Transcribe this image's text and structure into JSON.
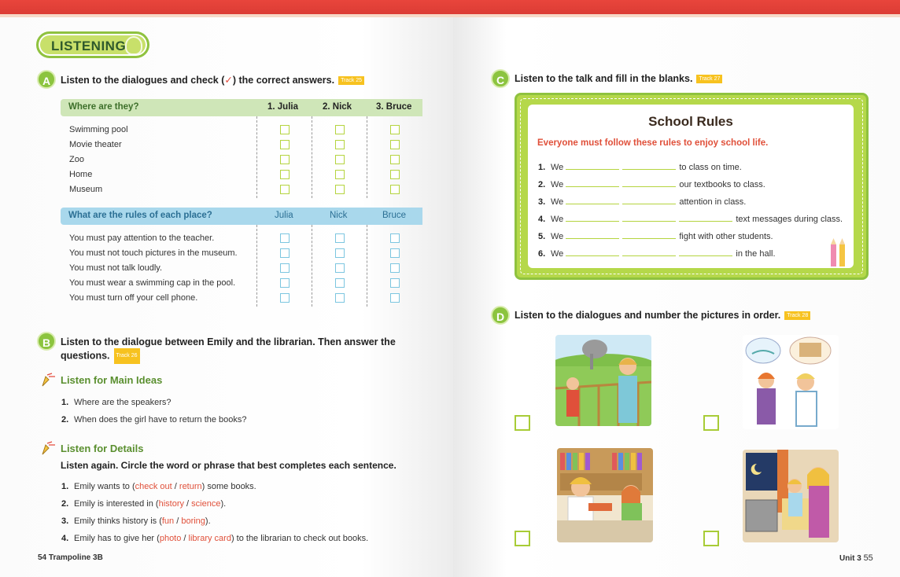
{
  "left_page": {
    "section_title": "LISTENING",
    "section_a": {
      "badge": "A",
      "instruction_before": "Listen to the dialogues and check (",
      "check_symbol": "✓",
      "instruction_after": ") the correct answers.",
      "track": "Track 25",
      "table1": {
        "headers": [
          "Where are they?",
          "1. Julia",
          "2. Nick",
          "3. Bruce"
        ],
        "rows": [
          "Swimming pool",
          "Movie theater",
          "Zoo",
          "Home",
          "Museum"
        ]
      },
      "table2": {
        "headers": [
          "What are the rules of each place?",
          "Julia",
          "Nick",
          "Bruce"
        ],
        "rows": [
          "You must pay attention to the teacher.",
          "You must not touch pictures in the museum.",
          "You must not talk loudly.",
          "You must wear a swimming cap in the pool.",
          "You must turn off your cell phone."
        ]
      }
    },
    "section_b": {
      "badge": "B",
      "instruction_line1": "Listen to the dialogue between Emily and the librarian. Then answer the",
      "instruction_line2": "questions.",
      "track": "Track 26",
      "main_ideas": {
        "heading": "Listen for Main Ideas",
        "items": [
          {
            "num": "1.",
            "text": "Where are the speakers?"
          },
          {
            "num": "2.",
            "text": "When does the girl have to return the books?"
          }
        ]
      },
      "details": {
        "heading": "Listen for Details",
        "instruction": "Listen again. Circle the word or phrase that best completes each sentence.",
        "items": [
          {
            "num": "1.",
            "pre": "Emily wants to (",
            "opt1": "check out",
            "sep": " / ",
            "opt2": "return",
            "post": ") some books."
          },
          {
            "num": "2.",
            "pre": "Emily is interested in (",
            "opt1": "history",
            "sep": " / ",
            "opt2": "science",
            "post": ")."
          },
          {
            "num": "3.",
            "pre": "Emily thinks history is (",
            "opt1": "fun",
            "sep": " / ",
            "opt2": "boring",
            "post": ")."
          },
          {
            "num": "4.",
            "pre": "Emily has to give her (",
            "opt1": "photo",
            "sep": " / ",
            "opt2": "library card",
            "post": ") to the librarian to check out books."
          }
        ]
      }
    },
    "footer": "54 Trampoline 3B"
  },
  "right_page": {
    "section_c": {
      "badge": "C",
      "instruction": "Listen to the talk and fill in the blanks.",
      "track": "Track 27",
      "card_title": "School Rules",
      "card_subtitle": "Everyone must follow these rules to enjoy school life.",
      "lines": [
        {
          "num": "1.",
          "pre": "We",
          "blanks": 2,
          "post": "to class on time."
        },
        {
          "num": "2.",
          "pre": "We",
          "blanks": 2,
          "post": "our textbooks to class."
        },
        {
          "num": "3.",
          "pre": "We",
          "blanks": 2,
          "post": "attention in class."
        },
        {
          "num": "4.",
          "pre": "We",
          "blanks": 3,
          "post": "text messages during class."
        },
        {
          "num": "5.",
          "pre": "We",
          "blanks": 2,
          "post": "fight with other students."
        },
        {
          "num": "6.",
          "pre": "We",
          "blanks": 3,
          "post": "in the hall."
        }
      ]
    },
    "section_d": {
      "badge": "D",
      "instruction": "Listen to the dialogues and number the pictures in order.",
      "track": "Track 28"
    },
    "footer_unit": "Unit 3",
    "footer_page": "55"
  },
  "colors": {
    "top_bar": "#e8453c",
    "green_badge": "#8cc43f",
    "table1_header": "#cfe6b8",
    "table2_header": "#a9d8ec",
    "answer_red": "#e0503a",
    "track_yellow": "#f7c21f"
  }
}
